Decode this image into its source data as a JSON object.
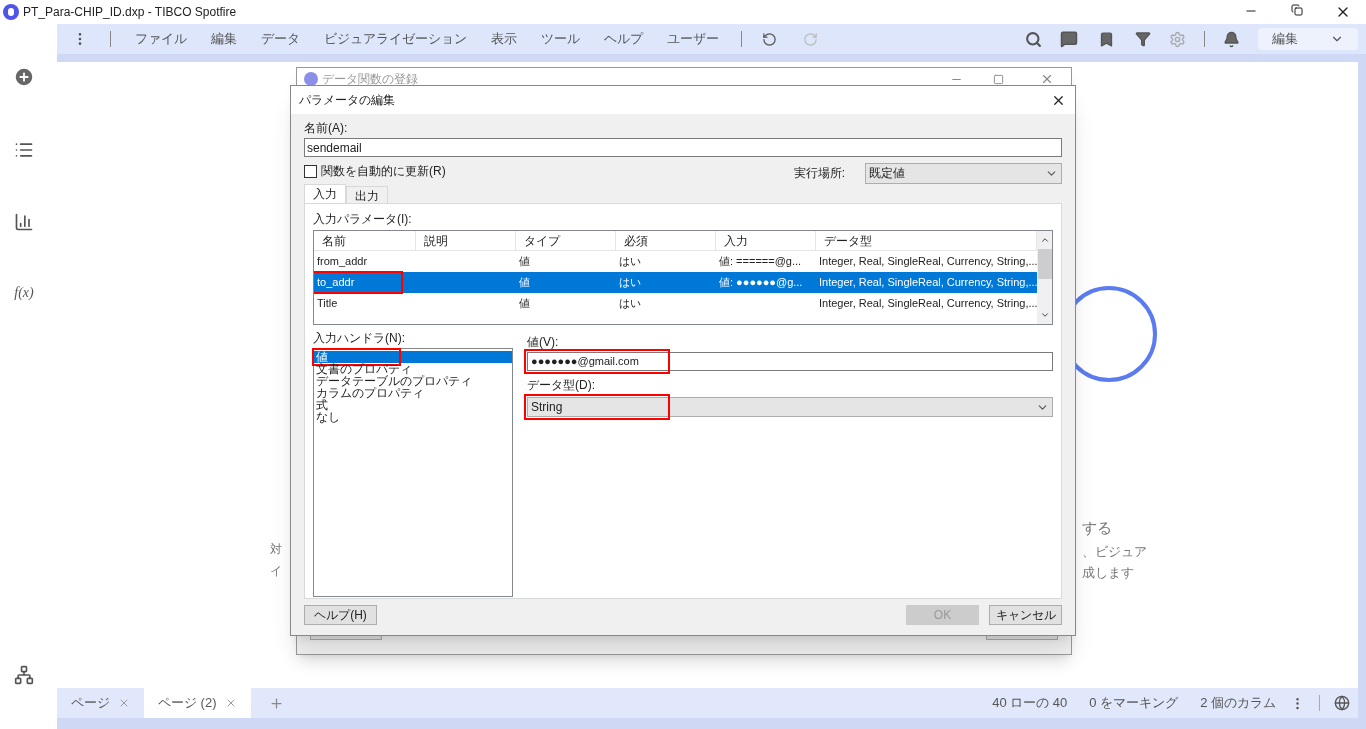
{
  "window": {
    "title": "PT_Para-CHIP_ID.dxp - TIBCO Spotfire"
  },
  "menu": [
    "ファイル",
    "編集",
    "データ",
    "ビジュアライゼーション",
    "表示",
    "ツール",
    "ヘルプ",
    "ユーザー"
  ],
  "mode_select": {
    "value": "編集"
  },
  "sidebar": {
    "function_label": "f(x)"
  },
  "background_fragments": [
    {
      "text": "する",
      "kind": "right"
    },
    {
      "text": "対",
      "kind": "left"
    },
    {
      "text": "、ビジュア",
      "kind": "right"
    },
    {
      "text": "イ",
      "kind": "left"
    },
    {
      "text": "成します",
      "kind": "right"
    }
  ],
  "back_dialog": {
    "title": "データ関数の登録"
  },
  "dialog": {
    "title": "パラメータの編集",
    "name_label": "名前(A):",
    "name_value": "sendemail",
    "auto_update": {
      "label": "関数を自動的に更新(R)",
      "checked": false
    },
    "location_label": "実行場所:",
    "location_value": "既定値",
    "tabs": [
      {
        "label": "入力",
        "selected": true
      },
      {
        "label": "出力",
        "selected": false
      }
    ],
    "params_label": "入力パラメータ(I):",
    "columns": [
      "名前",
      "説明",
      "タイプ",
      "必須",
      "入力",
      "データ型"
    ],
    "rows": [
      {
        "cells": [
          "from_addr",
          "",
          "値",
          "はい",
          "値: ======@g...",
          "Integer, Real, SingleReal, Currency, String,..."
        ],
        "selected": false,
        "highlighted": false
      },
      {
        "cells": [
          "to_addr",
          "",
          "値",
          "はい",
          "値: ●●●●●●@g...",
          "Integer, Real, SingleReal, Currency, String,..."
        ],
        "selected": true,
        "highlighted": true
      },
      {
        "cells": [
          "Title",
          "",
          "値",
          "はい",
          "",
          "Integer, Real, SingleReal, Currency, String,..."
        ],
        "selected": false,
        "highlighted": false
      }
    ],
    "handler_label": "入力ハンドラ(N):",
    "handlers": [
      {
        "label": "値",
        "selected": true,
        "highlighted": true
      },
      {
        "label": "文書のプロパティ",
        "selected": false,
        "highlighted": false
      },
      {
        "label": "データテーブルのプロパティ",
        "selected": false,
        "highlighted": false
      },
      {
        "label": "カラムのプロパティ",
        "selected": false,
        "highlighted": false
      },
      {
        "label": "式",
        "selected": false,
        "highlighted": false
      },
      {
        "label": "なし",
        "selected": false,
        "highlighted": false
      }
    ],
    "value_label": "値(V):",
    "value": {
      "text": "●●●●●●●@gmail.com",
      "highlighted": true
    },
    "type_label": "データ型(D):",
    "type": {
      "text": "String",
      "highlighted": true
    },
    "buttons": [
      {
        "label": "ヘルプ(H)",
        "disabled": false,
        "kind": "left"
      },
      {
        "label": "OK",
        "disabled": true,
        "kind": "right"
      },
      {
        "label": "キャンセル",
        "disabled": false,
        "kind": "right"
      }
    ]
  },
  "page_tabs": [
    {
      "label": "ページ",
      "selected": false
    },
    {
      "label": "ページ (2)",
      "selected": true
    }
  ],
  "status": [
    "40 ローの 40",
    "0 をマーキング",
    "2 個のカラム"
  ]
}
